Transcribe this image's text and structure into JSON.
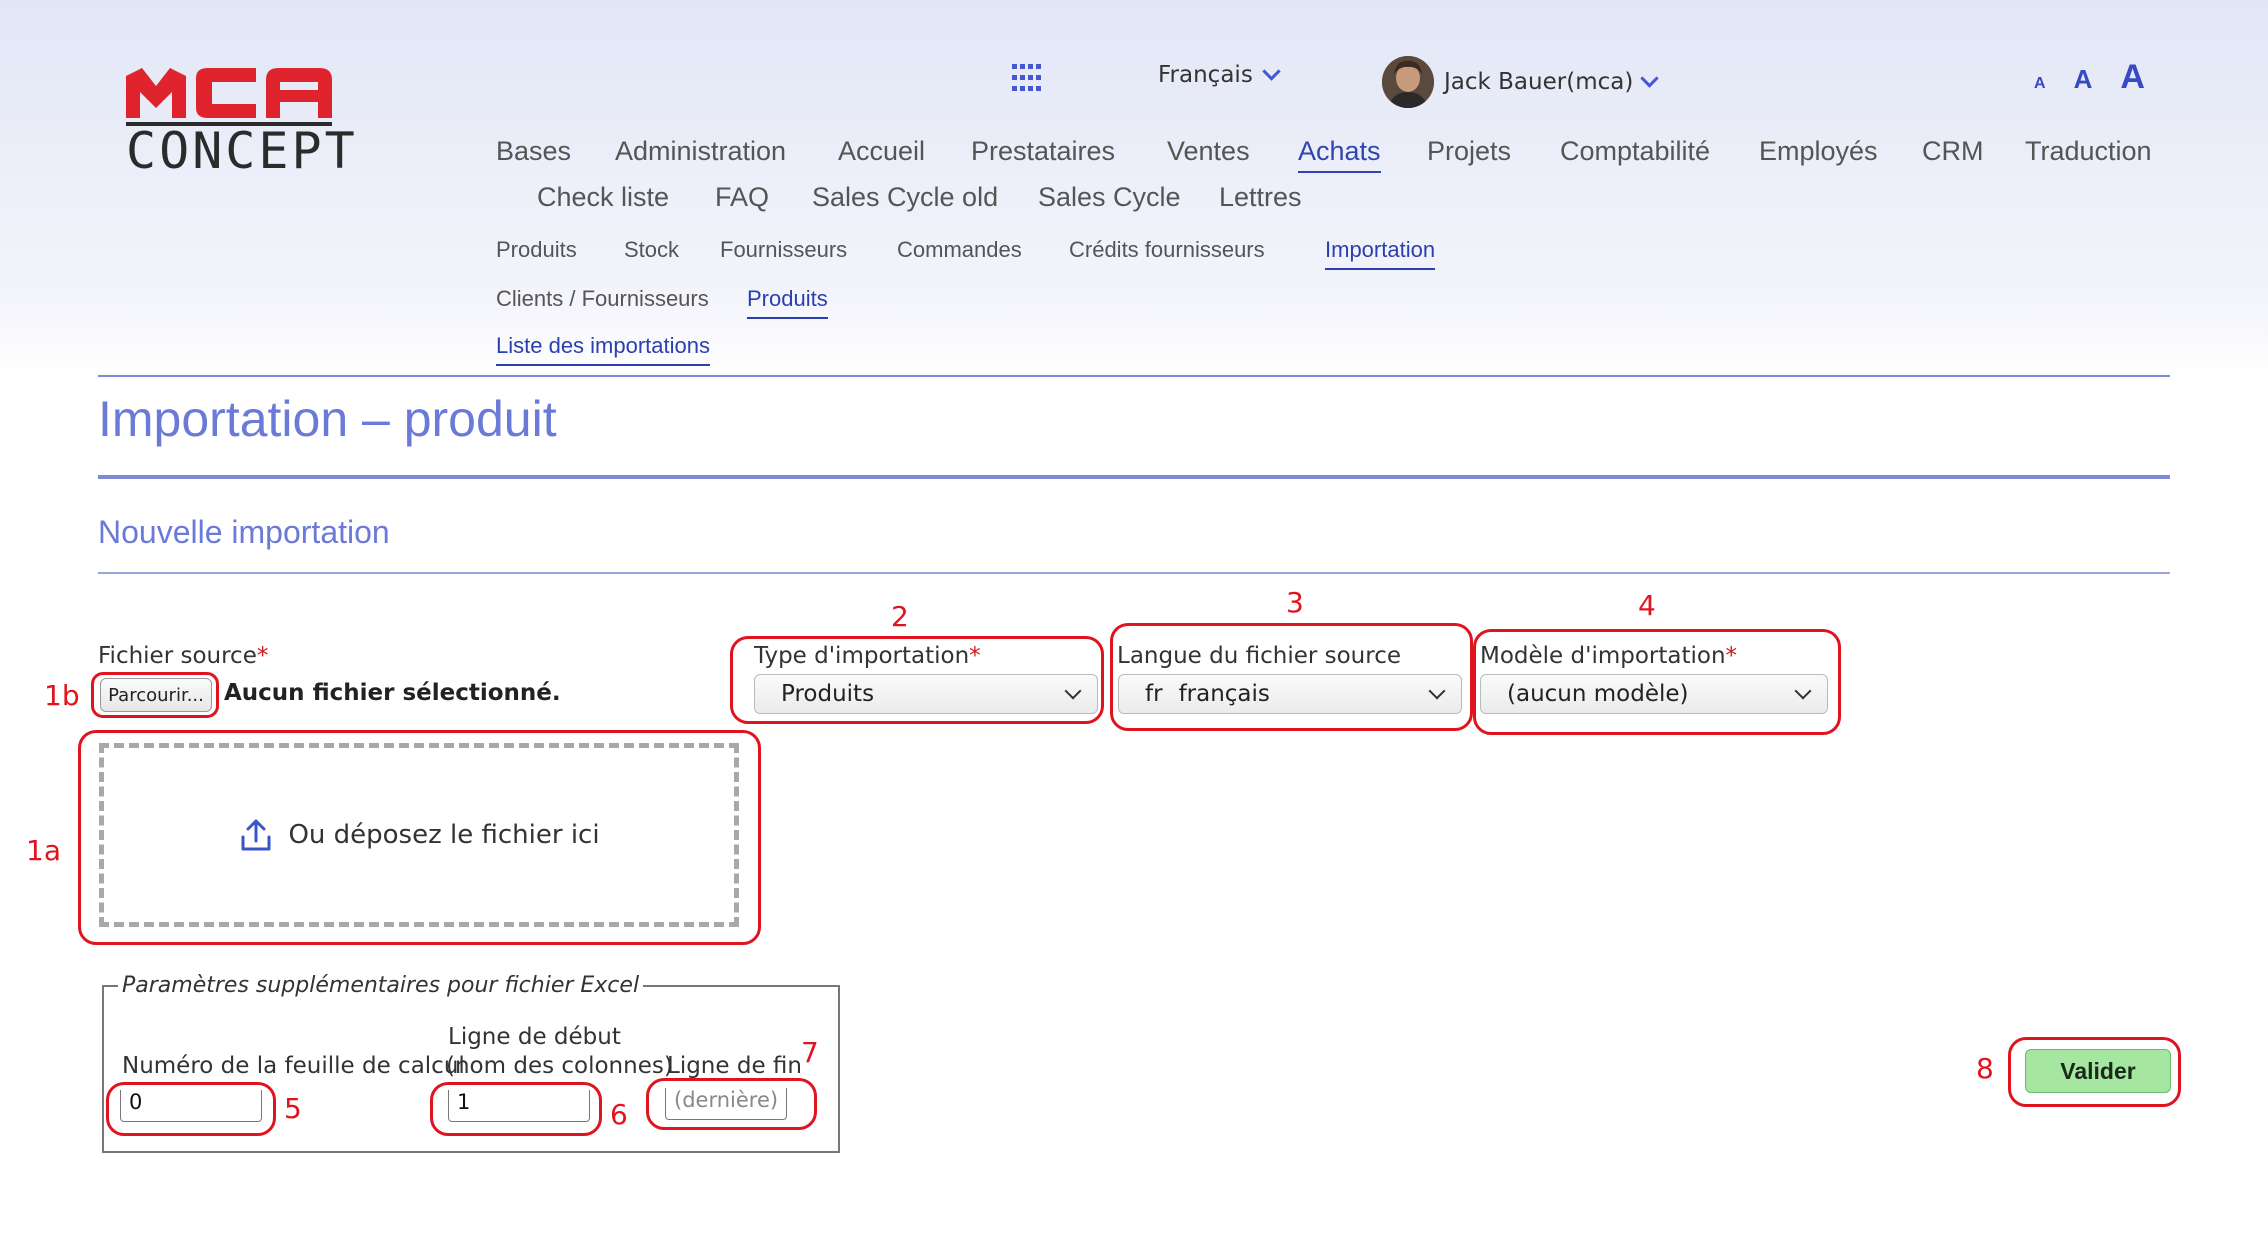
{
  "brand": {
    "logo_top": "MCA",
    "logo_bottom": "CONCEPT"
  },
  "topbar": {
    "apps_icon": "grid-icon",
    "language": "Français",
    "user_name": "Jack Bauer",
    "user_login": "(mca)",
    "font_sizes": [
      "A",
      "A",
      "A"
    ]
  },
  "main_nav": {
    "items": [
      "Bases",
      "Administration",
      "Accueil",
      "Prestataires",
      "Ventes",
      "Achats",
      "Projets",
      "Comptabilité",
      "Employés",
      "CRM",
      "Traduction",
      "Check liste",
      "FAQ",
      "Sales Cycle old",
      "Sales Cycle",
      "Lettres"
    ],
    "active": "Achats"
  },
  "sub_nav": {
    "row1": [
      "Produits",
      "Stock",
      "Fournisseurs",
      "Commandes",
      "Crédits fournisseurs",
      "Importation"
    ],
    "row1_active": "Importation",
    "row2": [
      "Clients / Fournisseurs",
      "Produits"
    ],
    "row2_active": "Produits",
    "row3": [
      "Liste des importations"
    ]
  },
  "page": {
    "title": "Importation – produit",
    "section": "Nouvelle importation"
  },
  "form": {
    "source_file_label": "Fichier source",
    "required_mark": "*",
    "browse_button": "Parcourir...",
    "no_file": "Aucun fichier sélectionné.",
    "drop_text": "Ou déposez le fichier ici",
    "import_type_label": "Type d'importation",
    "import_type_value": "Produits",
    "source_language_label": "Langue du fichier source",
    "source_language_code": "fr",
    "source_language_value": "français",
    "template_label": "Modèle d'importation",
    "template_value": "(aucun modèle)",
    "excel_legend": "Paramètres supplémentaires pour fichier Excel",
    "sheet_label": "Numéro de la feuille de calcul",
    "sheet_value": "0",
    "start_line_label_1": "Ligne de début",
    "start_line_label_2": "(nom des colonnes)",
    "start_line_value": "1",
    "end_line_label": "Ligne de fin",
    "end_line_placeholder": "(dernière)",
    "submit": "Valider"
  },
  "annotations": [
    "1a",
    "1b",
    "2",
    "3",
    "4",
    "5",
    "6",
    "7",
    "8"
  ],
  "colors": {
    "accent": "#3145b0",
    "title": "#6b7ad6",
    "annotation": "#e0141e",
    "submit": "#a5e6a0",
    "logo_red": "#e0242e",
    "logo_dark": "#2b2b2b"
  }
}
